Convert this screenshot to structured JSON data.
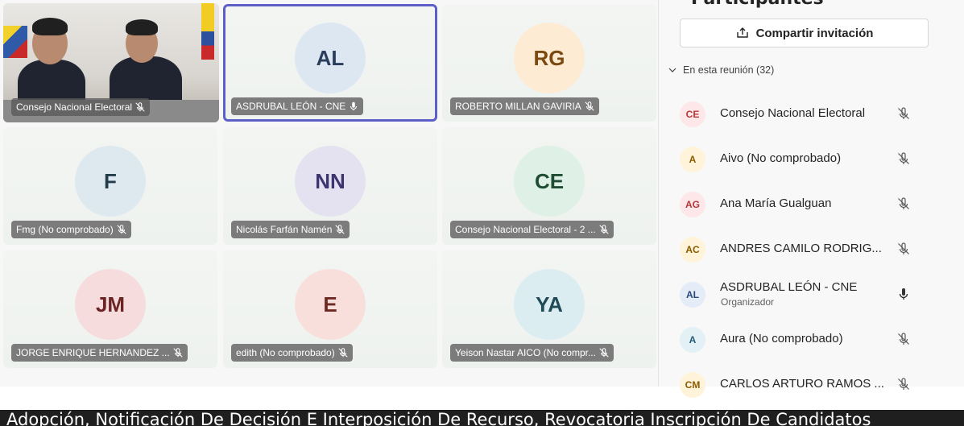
{
  "panel": {
    "header": "Participantes",
    "share_label": "Compartir invitación",
    "section_label": "En esta reunión (32)",
    "participants": [
      {
        "initials": "CE",
        "name": "Consejo Nacional Electoral",
        "role": "",
        "mic": "muted",
        "avatar_bg": "#fde7e9",
        "avatar_fg": "#b6383a"
      },
      {
        "initials": "A",
        "name": "Aivo (No comprobado)",
        "role": "",
        "mic": "muted",
        "avatar_bg": "#fff3d9",
        "avatar_fg": "#8a5a00"
      },
      {
        "initials": "AG",
        "name": "Ana María Gualguan",
        "role": "",
        "mic": "muted",
        "avatar_bg": "#fde7e9",
        "avatar_fg": "#b6383a"
      },
      {
        "initials": "AC",
        "name": "ANDRES CAMILO RODRIG...",
        "role": "",
        "mic": "muted",
        "avatar_bg": "#fff3d9",
        "avatar_fg": "#8a5a00"
      },
      {
        "initials": "AL",
        "name": "ASDRUBAL LEÓN - CNE",
        "role": "Organizador",
        "mic": "on",
        "avatar_bg": "#e3ecf7",
        "avatar_fg": "#2b4a7a"
      },
      {
        "initials": "A",
        "name": "Aura (No comprobado)",
        "role": "",
        "mic": "muted",
        "avatar_bg": "#e3f1f7",
        "avatar_fg": "#1f5d75"
      },
      {
        "initials": "CM",
        "name": "CARLOS ARTURO RAMOS ...",
        "role": "",
        "mic": "muted",
        "avatar_bg": "#fff3d9",
        "avatar_fg": "#8a5a00"
      }
    ]
  },
  "tiles": [
    {
      "type": "video",
      "name": "Consejo Nacional Electoral",
      "mic": "muted"
    },
    {
      "type": "avatar",
      "initials": "AL",
      "name": "ASDRUBAL LEÓN - CNE",
      "mic": "on",
      "active": true,
      "avatar_bg": "#dde7f2",
      "avatar_fg": "#2a3e5c"
    },
    {
      "type": "avatar",
      "initials": "RG",
      "name": "ROBERTO MILLAN GAVIRIA",
      "mic": "muted",
      "avatar_bg": "#fdebd3",
      "avatar_fg": "#7a4a10"
    },
    {
      "type": "avatar",
      "initials": "F",
      "name": "Fmg (No comprobado)",
      "mic": "muted",
      "avatar_bg": "#dde9ef",
      "avatar_fg": "#243c4a"
    },
    {
      "type": "avatar",
      "initials": "NN",
      "name": "Nicolás Farfán Namén",
      "mic": "muted",
      "avatar_bg": "#e4e1f1",
      "avatar_fg": "#3c3570"
    },
    {
      "type": "avatar",
      "initials": "CE",
      "name": "Consejo Nacional Electoral - 2 ...",
      "mic": "muted",
      "avatar_bg": "#dff0e6",
      "avatar_fg": "#1f4d33"
    },
    {
      "type": "avatar",
      "initials": "JM",
      "name": "JORGE ENRIQUE HERNANDEZ ...",
      "mic": "muted",
      "avatar_bg": "#f6dcdc",
      "avatar_fg": "#6b2323"
    },
    {
      "type": "avatar",
      "initials": "E",
      "name": "edith (No comprobado)",
      "mic": "muted",
      "avatar_bg": "#f9dfdc",
      "avatar_fg": "#6e2a22"
    },
    {
      "type": "avatar",
      "initials": "YA",
      "name": "Yeison Nastar AICO (No compr...",
      "mic": "muted",
      "avatar_bg": "#dcedf2",
      "avatar_fg": "#1f4a57"
    }
  ],
  "caption": "Adopción, Notificación De Decisión E Interposición De Recurso, Revocatoria Inscripción De Candidatos"
}
